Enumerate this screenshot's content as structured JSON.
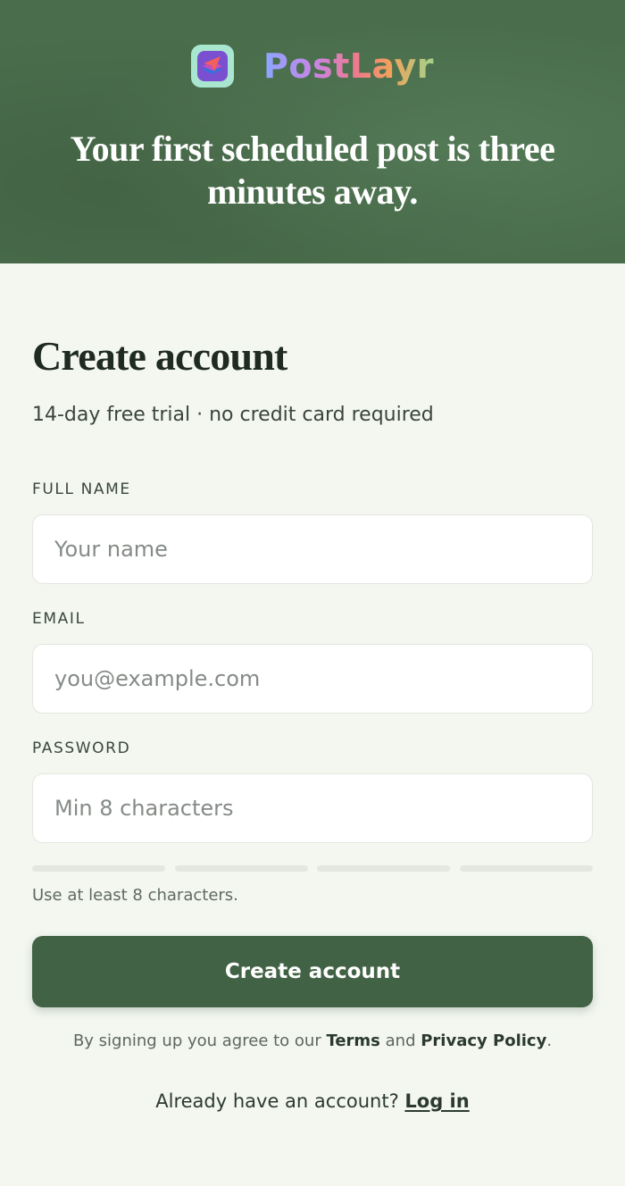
{
  "brand": {
    "name": "PostLayr",
    "logo_icon": "layers-paper-plane-icon"
  },
  "hero": {
    "headline": "Your first scheduled post is three minutes away."
  },
  "form": {
    "title": "Create account",
    "subtitle": "14-day free trial · no credit card required",
    "fields": {
      "full_name": {
        "label": "FULL NAME",
        "placeholder": "Your name",
        "value": ""
      },
      "email": {
        "label": "EMAIL",
        "placeholder": "you@example.com",
        "value": ""
      },
      "password": {
        "label": "PASSWORD",
        "placeholder": "Min 8 characters",
        "value": ""
      }
    },
    "password_strength": {
      "segments": 4,
      "filled": 0
    },
    "password_hint": "Use at least 8 characters.",
    "submit_label": "Create account",
    "legal": {
      "prefix": "By signing up you agree to our ",
      "terms": "Terms",
      "middle": " and ",
      "privacy": "Privacy Policy",
      "suffix": "."
    },
    "login": {
      "prompt": "Already have an account? ",
      "link_label": "Log in"
    }
  },
  "colors": {
    "hero_bg": "#4a6e4c",
    "page_bg": "#f3f7f0",
    "primary_button": "#426245",
    "logo_bg": "#a8e6cf"
  }
}
